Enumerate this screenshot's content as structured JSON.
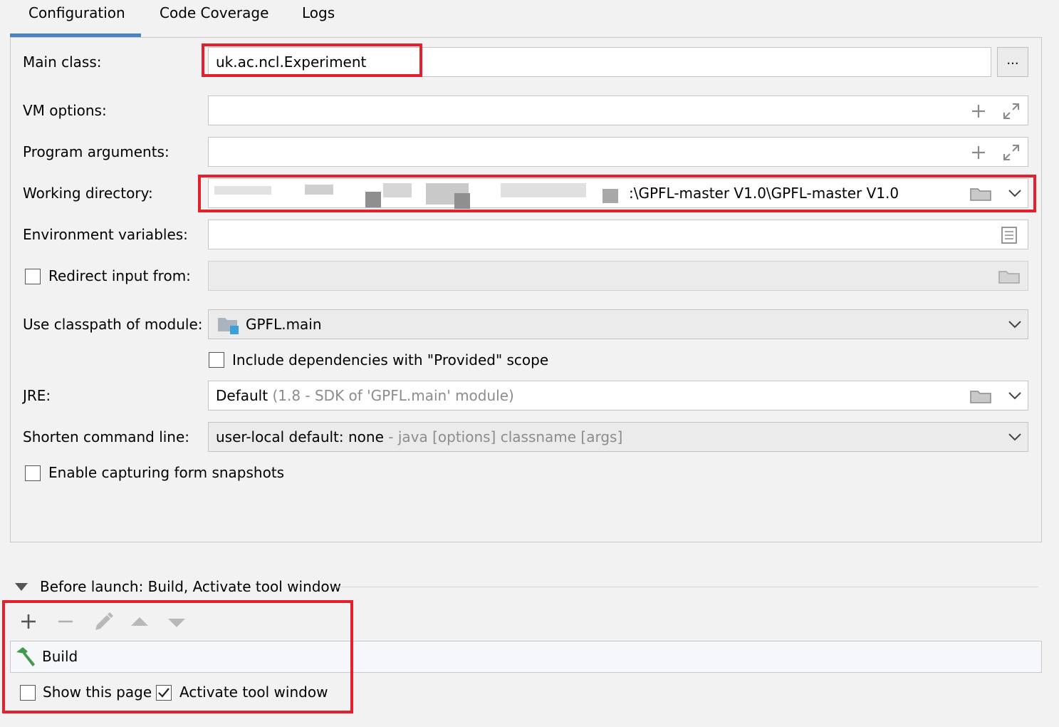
{
  "tabs": [
    {
      "label": "Configuration",
      "active": true
    },
    {
      "label": "Code Coverage"
    },
    {
      "label": "Logs"
    }
  ],
  "form": {
    "main_class_label": "Main class:",
    "main_class_value": "uk.ac.ncl.Experiment",
    "browse_label": "...",
    "vm_options_label": "VM options:",
    "program_args_label": "Program arguments:",
    "working_dir_label": "Working directory:",
    "working_dir_value": ":\\GPFL-master  V1.0\\GPFL-master V1.0",
    "env_vars_label": "Environment variables:",
    "redirect_label": "Redirect input from:",
    "classpath_label": "Use classpath of module:",
    "classpath_value": "GPFL.main",
    "include_deps_label": "Include dependencies with \"Provided\" scope",
    "jre_label": "JRE:",
    "jre_value": "Default",
    "jre_hint": "(1.8 - SDK of 'GPFL.main' module)",
    "shorten_label": "Shorten command line:",
    "shorten_value": "user-local default: none",
    "shorten_hint": "- java [options] classname [args]",
    "snapshots_label": "Enable capturing form snapshots"
  },
  "before_launch": {
    "title": "Before launch: Build, Activate tool window",
    "items": [
      "Build"
    ],
    "show_page_label": "Show this page",
    "show_page_checked": false,
    "activate_label": "Activate tool window",
    "activate_checked": true
  },
  "colors": {
    "tab_underline": "#4a83c4",
    "highlight_box": "#e3202b",
    "build_icon": "#3f9a4d",
    "module_icon": "#39a0d8"
  }
}
